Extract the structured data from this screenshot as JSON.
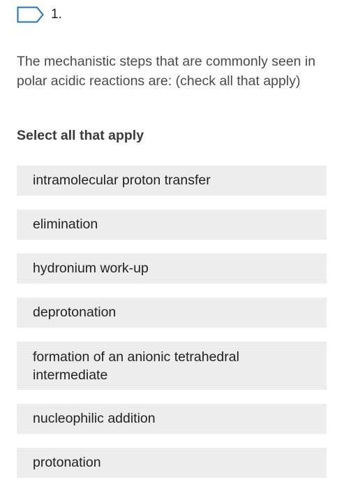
{
  "question": {
    "number": "1.",
    "flag_icon": "flag-outline-icon",
    "flag_color": "#1a73c9",
    "prompt": "The mechanistic steps that are commonly seen in polar acidic reactions are: (check all that apply)",
    "instruction": "Select all that apply"
  },
  "options": [
    {
      "label": "intramolecular proton transfer"
    },
    {
      "label": "elimination"
    },
    {
      "label": "hydronium work-up"
    },
    {
      "label": "deprotonation"
    },
    {
      "label": "formation of an anionic tetrahedral intermediate"
    },
    {
      "label": "nucleophilic addition"
    },
    {
      "label": "protonation"
    }
  ]
}
